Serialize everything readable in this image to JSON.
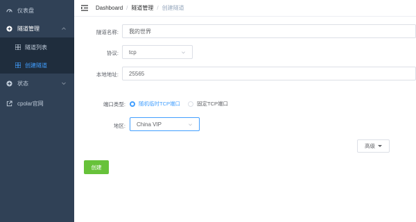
{
  "sidebar": {
    "items": [
      {
        "label": "仪表盘",
        "icon": "dashboard-icon"
      },
      {
        "label": "隧道管理",
        "icon": "plus-circle-icon",
        "expanded": true
      },
      {
        "label": "状态",
        "icon": "plus-circle-icon"
      },
      {
        "label": "cpolar官网",
        "icon": "external-link-icon"
      }
    ],
    "sub_items": [
      {
        "label": "隧道列表",
        "icon": "grid-icon"
      },
      {
        "label": "创建隧道",
        "icon": "grid-icon",
        "active": true
      }
    ],
    "colors": {
      "bg": "#304156",
      "sub_bg": "#1f2d3d",
      "text": "#bfcbd9",
      "active": "#409eff"
    }
  },
  "breadcrumb": [
    "Dashboard",
    "隧道管理",
    "创建隧道"
  ],
  "form": {
    "name": {
      "label": "隧道名称:",
      "value": "我的世界"
    },
    "protocol": {
      "label": "协议:",
      "value": "tcp"
    },
    "local_addr": {
      "label": "本地地址:",
      "value": "25565"
    },
    "port_type": {
      "label": "端口类型:",
      "options": [
        "随机临时TCP端口",
        "固定TCP端口"
      ],
      "selected": "随机临时TCP端口"
    },
    "region": {
      "label": "地区:",
      "value": "China VIP"
    }
  },
  "advanced_label": "高级",
  "create_label": "创建",
  "colors": {
    "primary": "#409eff",
    "success": "#67c23a"
  }
}
